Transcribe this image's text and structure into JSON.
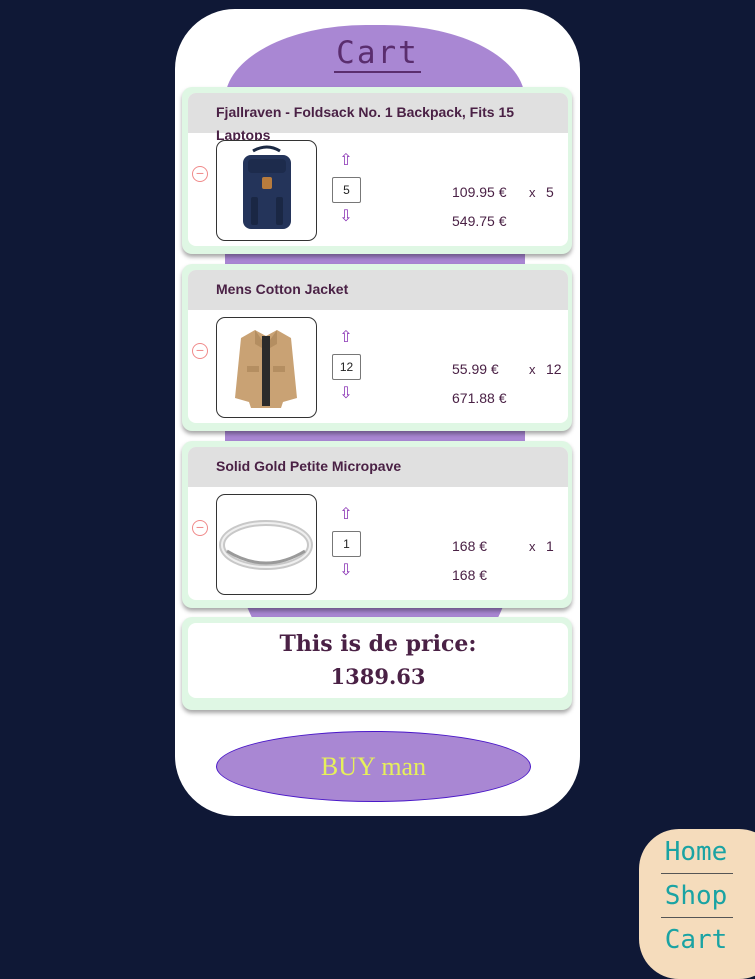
{
  "page": {
    "title": "Cart"
  },
  "items": [
    {
      "name": "Fjallraven - Foldsack No. 1 Backpack, Fits 15 Laptops",
      "quantity": "5",
      "unit_price": "109.95 €",
      "times": "x",
      "count": "5",
      "total": "549.75 €",
      "image_icon": "backpack-icon"
    },
    {
      "name": "Mens Cotton Jacket",
      "quantity": "12",
      "unit_price": "55.99 €",
      "times": "x",
      "count": "12",
      "total": "671.88 €",
      "image_icon": "jacket-icon"
    },
    {
      "name": "Solid Gold Petite Micropave",
      "quantity": "1",
      "unit_price": "168 €",
      "times": "x",
      "count": "1",
      "total": "168 €",
      "image_icon": "ring-icon"
    }
  ],
  "summary": {
    "label": "This is de price:",
    "value": "1389.63"
  },
  "buy_button": {
    "label": "BUY man"
  },
  "nav": {
    "home": "Home",
    "shop": "Shop",
    "cart": "Cart"
  },
  "colors": {
    "background": "#0f1836",
    "accent": "#a987d3",
    "text": "#4a2145",
    "buy_text": "#e6f05a",
    "nav_bg": "#f5dcbc",
    "nav_text": "#1aa3a3"
  }
}
